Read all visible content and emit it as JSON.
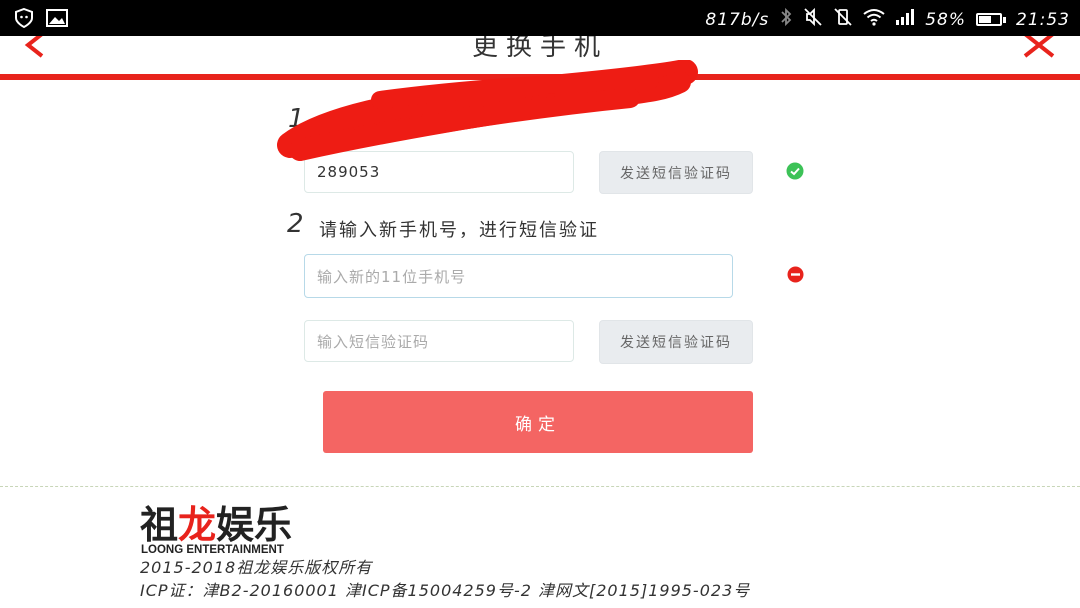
{
  "status_bar": {
    "speed": "817b/s",
    "battery_percent": "58%",
    "battery_level": 0.58,
    "time": "21:53"
  },
  "header": {
    "title": "更换手机"
  },
  "step1": {
    "number": "1",
    "code_value": "289053",
    "send_sms_label": "发送短信验证码",
    "status_icon": "check-circle-icon",
    "status_color": "#3cc257"
  },
  "step2": {
    "number": "2",
    "instruction": "请输入新手机号，进行短信验证",
    "phone_placeholder": "输入新的11位手机号",
    "phone_status_icon": "minus-circle-icon",
    "phone_status_color": "#e8231c",
    "code_placeholder": "输入短信验证码",
    "send_sms_label": "发送短信验证码"
  },
  "confirm_label": "确定",
  "colors": {
    "accent": "#e8231c",
    "confirm": "#f46563"
  },
  "footer": {
    "logo_text": "祖龙娱乐",
    "logo_subtext": "LOONG ENTERTAINMENT",
    "copyright": "2015-2018祖龙娱乐版权所有",
    "icp": "ICP证：津B2-20160001 津ICP备15004259号-2 津网文[2015]1995-023号"
  }
}
